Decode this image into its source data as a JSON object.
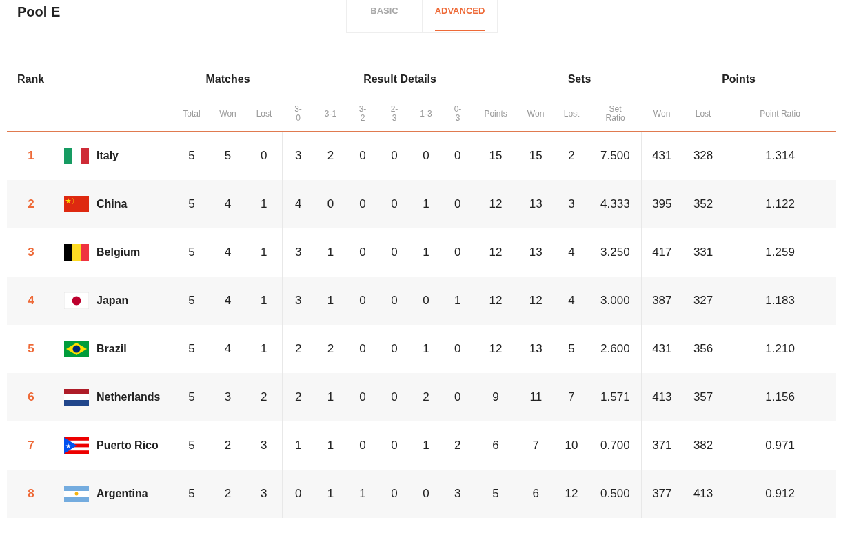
{
  "title": "Pool E",
  "tabs": [
    {
      "label": "BASIC",
      "selected": false
    },
    {
      "label": "ADVANCED",
      "selected": true
    }
  ],
  "group_headers": {
    "rank": "Rank",
    "matches": "Matches",
    "result_details": "Result Details",
    "sets": "Sets",
    "points": "Points"
  },
  "columns": [
    "Total",
    "Won",
    "Lost",
    "3-\n0",
    "3-1",
    "3-\n2",
    "2-\n3",
    "1-3",
    "0-\n3",
    "Points",
    "Won",
    "Lost",
    "Set\nRatio",
    "Won",
    "Lost",
    "Point Ratio"
  ],
  "rows": [
    {
      "rank": "1",
      "team": "Italy",
      "values": [
        "5",
        "5",
        "0",
        "3",
        "2",
        "0",
        "0",
        "0",
        "0",
        "15",
        "15",
        "2",
        "7.500",
        "431",
        "328",
        "1.314"
      ]
    },
    {
      "rank": "2",
      "team": "China",
      "values": [
        "5",
        "4",
        "1",
        "4",
        "0",
        "0",
        "0",
        "1",
        "0",
        "12",
        "13",
        "3",
        "4.333",
        "395",
        "352",
        "1.122"
      ]
    },
    {
      "rank": "3",
      "team": "Belgium",
      "values": [
        "5",
        "4",
        "1",
        "3",
        "1",
        "0",
        "0",
        "1",
        "0",
        "12",
        "13",
        "4",
        "3.250",
        "417",
        "331",
        "1.259"
      ]
    },
    {
      "rank": "4",
      "team": "Japan",
      "values": [
        "5",
        "4",
        "1",
        "3",
        "1",
        "0",
        "0",
        "0",
        "1",
        "12",
        "12",
        "4",
        "3.000",
        "387",
        "327",
        "1.183"
      ]
    },
    {
      "rank": "5",
      "team": "Brazil",
      "values": [
        "5",
        "4",
        "1",
        "2",
        "2",
        "0",
        "0",
        "1",
        "0",
        "12",
        "13",
        "5",
        "2.600",
        "431",
        "356",
        "1.210"
      ]
    },
    {
      "rank": "6",
      "team": "Netherlands",
      "values": [
        "5",
        "3",
        "2",
        "2",
        "1",
        "0",
        "0",
        "2",
        "0",
        "9",
        "11",
        "7",
        "1.571",
        "413",
        "357",
        "1.156"
      ]
    },
    {
      "rank": "7",
      "team": "Puerto Rico",
      "values": [
        "5",
        "2",
        "3",
        "1",
        "1",
        "0",
        "0",
        "1",
        "2",
        "6",
        "7",
        "10",
        "0.700",
        "371",
        "382",
        "0.971"
      ]
    },
    {
      "rank": "8",
      "team": "Argentina",
      "values": [
        "5",
        "2",
        "3",
        "0",
        "1",
        "1",
        "0",
        "0",
        "3",
        "5",
        "6",
        "12",
        "0.500",
        "377",
        "413",
        "0.912"
      ]
    }
  ]
}
